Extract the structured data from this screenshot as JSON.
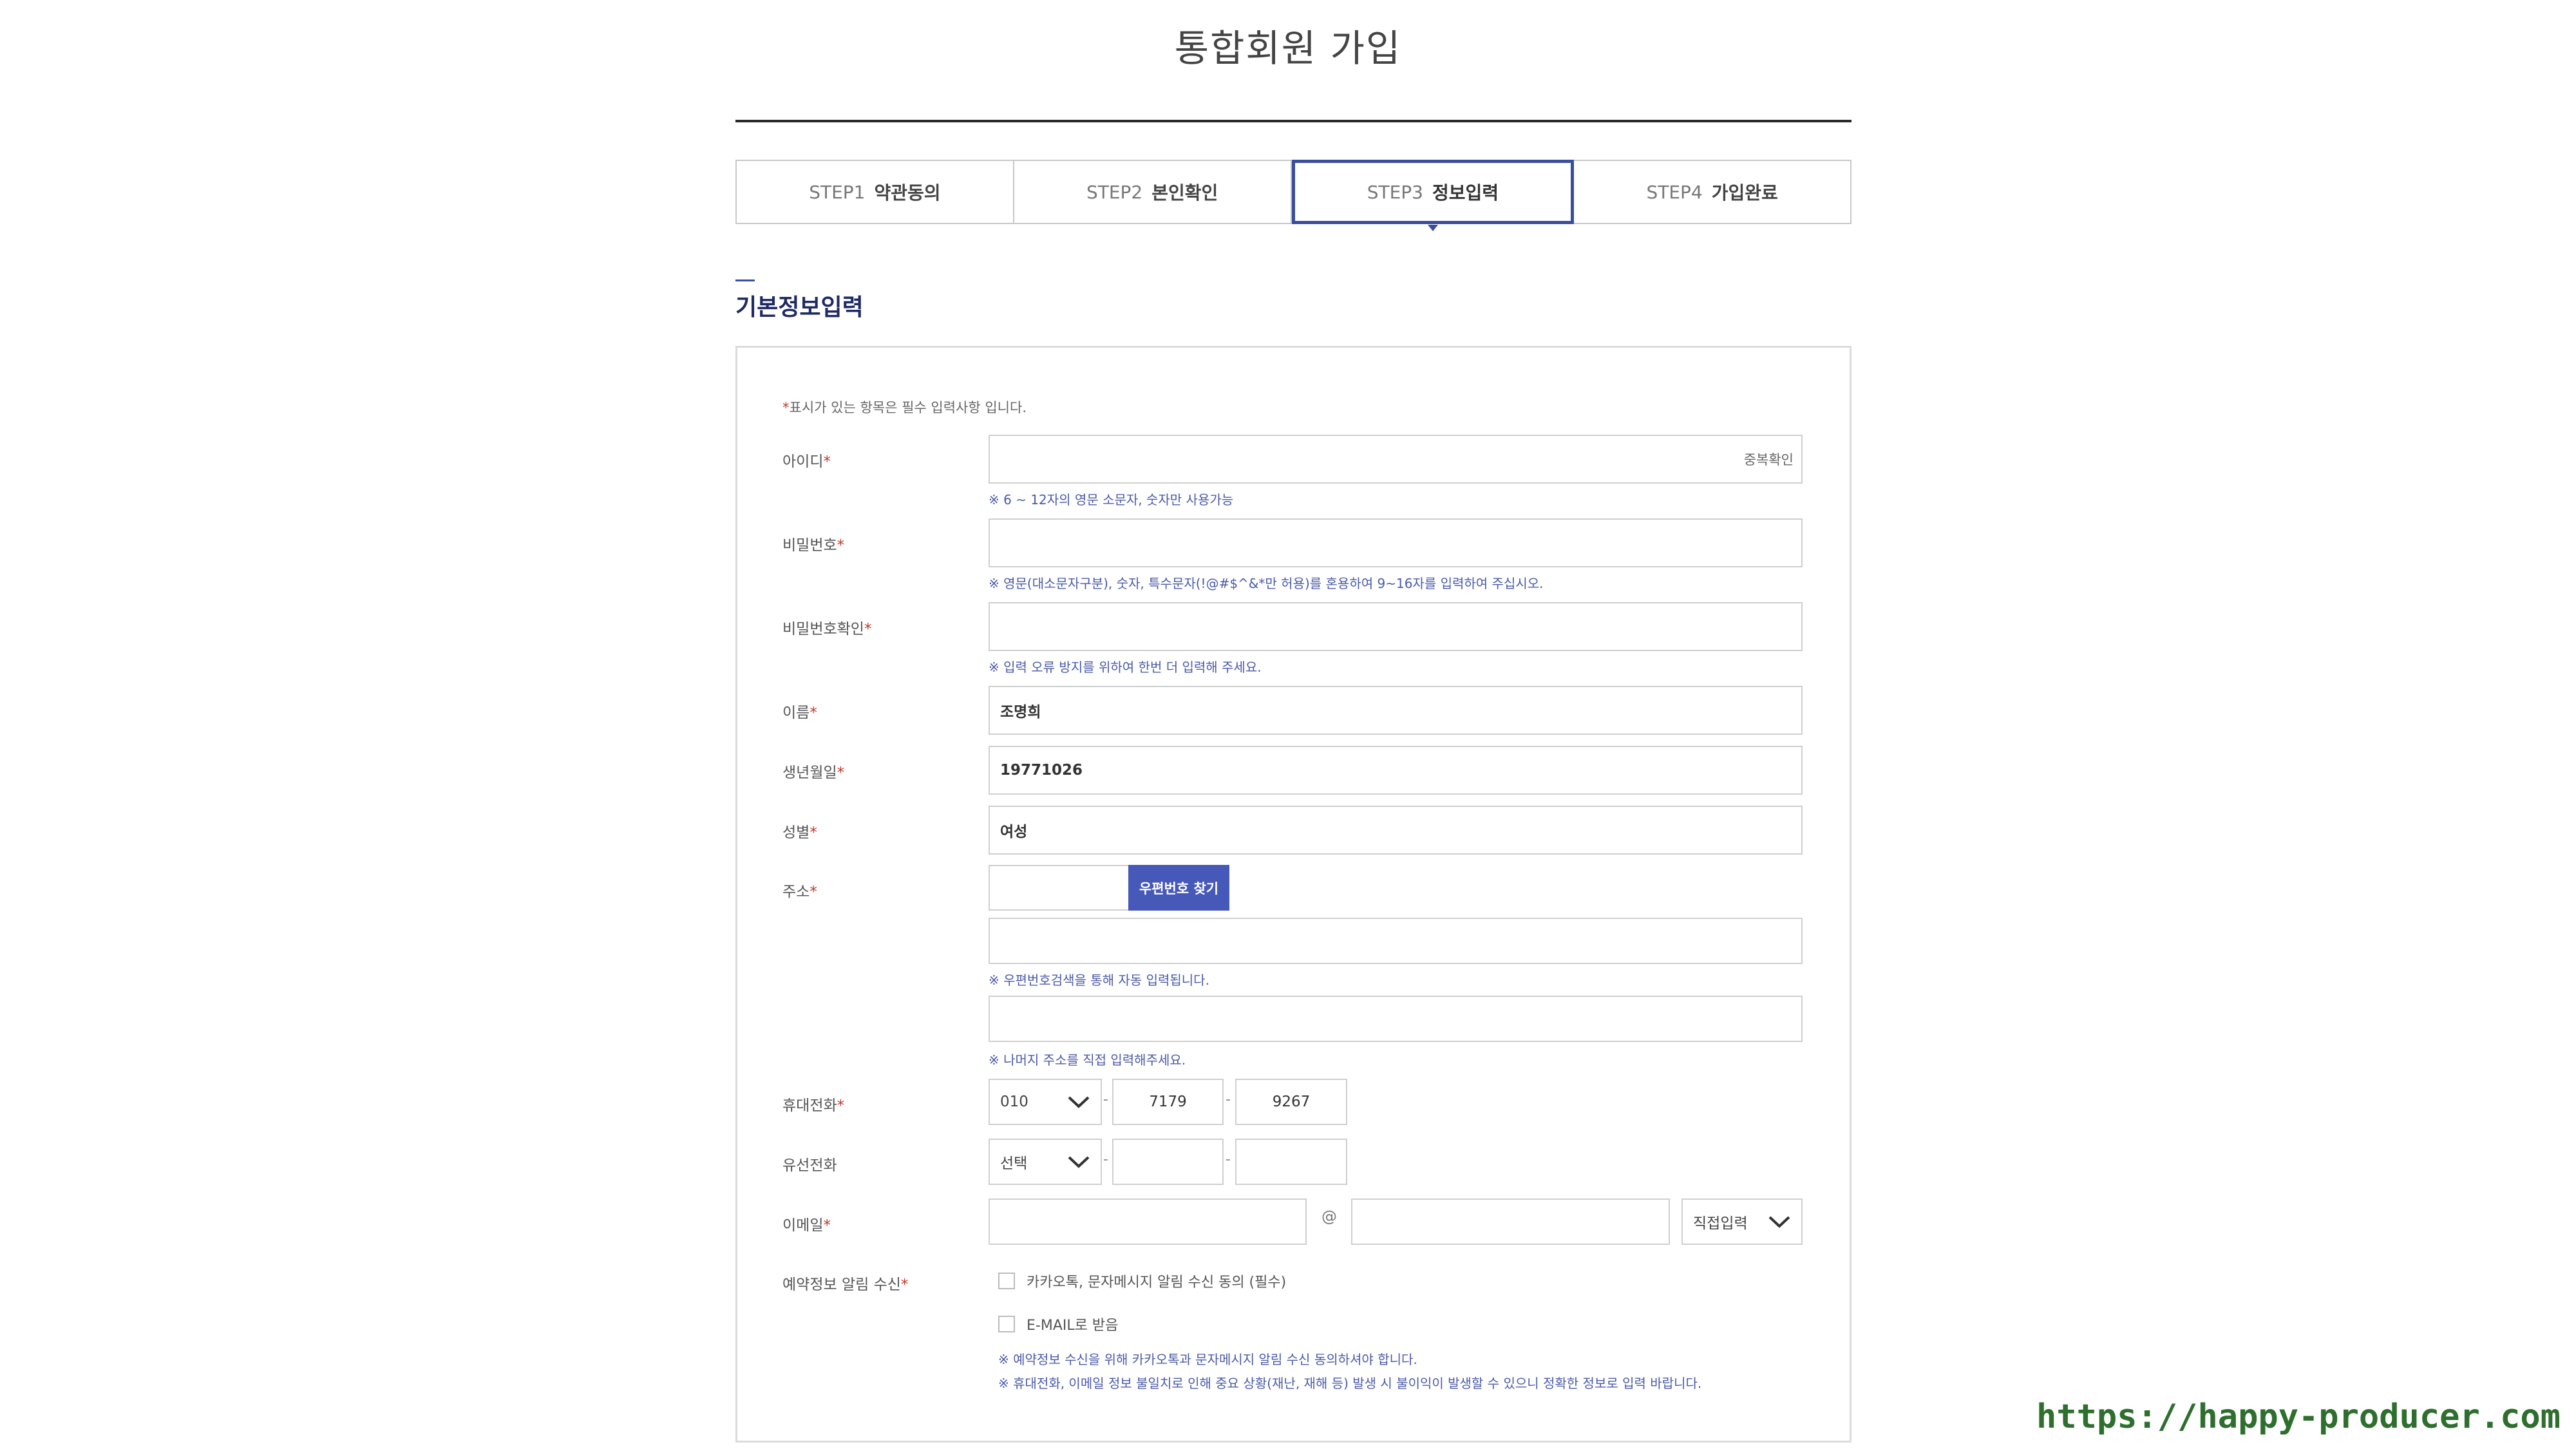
{
  "page": {
    "title": "통합회원 가입"
  },
  "steps": [
    {
      "num": "STEP1",
      "label": "약관동의",
      "active": false
    },
    {
      "num": "STEP2",
      "label": "본인확인",
      "active": false
    },
    {
      "num": "STEP3",
      "label": "정보입력",
      "active": true
    },
    {
      "num": "STEP4",
      "label": "가입완료",
      "active": false
    }
  ],
  "section": {
    "title": "기본정보입력"
  },
  "form": {
    "required_mark": "*",
    "required_note": "표시가 있는 항목은 필수 입력사항 입니다.",
    "id": {
      "label": "아이디",
      "value": "",
      "dup_check": "중복확인",
      "hint": "※ 6 ~ 12자의 영문 소문자, 숫자만 사용가능"
    },
    "password": {
      "label": "비밀번호",
      "value": "",
      "hint": "※ 영문(대소문자구분), 숫자, 특수문자(!@#$^&*만 허용)를 혼용하여 9~16자를 입력하여 주십시오."
    },
    "password_confirm": {
      "label": "비밀번호확인",
      "value": "",
      "hint": "※ 입력 오류 방지를 위하여 한번 더 입력해 주세요."
    },
    "name": {
      "label": "이름",
      "value": "조명희"
    },
    "birth": {
      "label": "생년월일",
      "value": "19771026"
    },
    "gender": {
      "label": "성별",
      "value": "여성"
    },
    "address": {
      "label": "주소",
      "zip": "",
      "zip_button": "우편번호 찾기",
      "addr1": "",
      "addr1_hint": "※ 우편번호검색을 통해 자동 입력됩니다.",
      "addr2": "",
      "addr2_hint": "※ 나머지 주소를 직접 입력해주세요."
    },
    "mobile": {
      "label": "휴대전화",
      "prefix": "010",
      "mid": "7179",
      "last": "9267"
    },
    "landline": {
      "label": "유선전화",
      "prefix": "선택",
      "mid": "",
      "last": ""
    },
    "email": {
      "label": "이메일",
      "local": "",
      "at": "@",
      "domain": "",
      "domain_select": "직접입력"
    },
    "notify": {
      "label": "예약정보 알림 수신",
      "option1": "카카오톡, 문자메시지 알림 수신 동의 (필수)",
      "option2": "E-MAIL로 받음",
      "hint1": "※ 예약정보 수신을 위해 카카오톡과 문자메시지 알림 수신 동의하셔야 합니다.",
      "hint2": "※ 휴대전화, 이메일 정보 불일치로 인해 중요 상황(재난, 재해 등) 발생 시 불이익이 발생할 수 있으니 정확한 정보로 입력 바랍니다."
    }
  },
  "watermark": "https://happy-producer.com",
  "colors": {
    "accent": "#3a4ea0",
    "button": "#4658b8",
    "hint": "#4a5aa8",
    "required": "#c0392b",
    "watermark": "#2e6f2e"
  }
}
